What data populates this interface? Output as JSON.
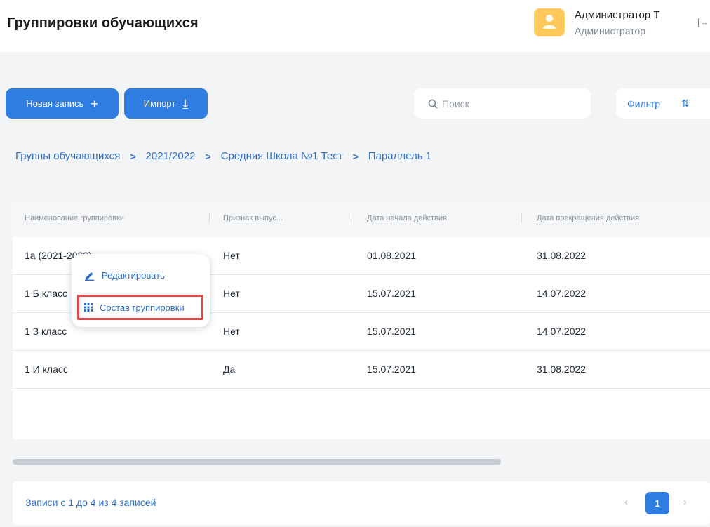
{
  "header": {
    "title": "Группировки обучающихся",
    "user": {
      "name": "Администратор Т",
      "role": "Администратор"
    },
    "logout_icon_text": "[→"
  },
  "toolbar": {
    "new_record_label": "Новая запись",
    "new_record_icon": "+",
    "import_label": "Импорт",
    "import_icon": "⤓",
    "search_placeholder": "Поиск",
    "filter_label": "Фильтр",
    "settings_icon": "⇅"
  },
  "breadcrumb": {
    "items": [
      "Группы обучающихся",
      "2021/2022",
      "Средняя Школа №1 Тест",
      "Параллель 1"
    ],
    "separator": ">"
  },
  "table": {
    "columns": [
      "Наименование группировки",
      "Признак выпус...",
      "Дата начала действия",
      "Дата прекращения действия"
    ],
    "rows": [
      [
        "1а (2021-2022)",
        "Нет",
        "01.08.2021",
        "31.08.2022"
      ],
      [
        "1 Б класс",
        "Нет",
        "15.07.2021",
        "14.07.2022"
      ],
      [
        "1 З класс",
        "Нет",
        "15.07.2021",
        "14.07.2022"
      ],
      [
        "1 И класс",
        "Да",
        "15.07.2021",
        "31.08.2022"
      ]
    ]
  },
  "context_menu": {
    "items": [
      {
        "label": "Редактировать",
        "icon": "pencil-icon"
      },
      {
        "label": "Состав группировки",
        "icon": "grid-icon"
      }
    ]
  },
  "footer": {
    "records_info": "Записи с 1 до 4 из 4 записей",
    "prev": "‹",
    "current_page": "1",
    "next": "›"
  },
  "colors": {
    "accent": "#2f7de1",
    "link": "#2f6fc9",
    "avatar": "#ffc95c",
    "highlight": "#e0494a"
  }
}
